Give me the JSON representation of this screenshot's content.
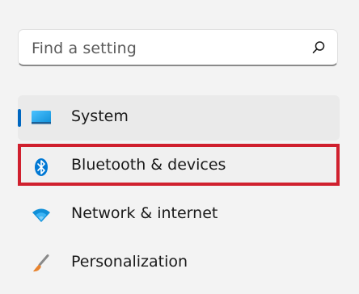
{
  "search": {
    "placeholder": "Find a setting",
    "icon": "search-icon"
  },
  "nav": {
    "items": [
      {
        "label": "System",
        "icon": "system-monitor-icon",
        "selected": true
      },
      {
        "label": "Bluetooth & devices",
        "icon": "bluetooth-icon",
        "highlighted": true
      },
      {
        "label": "Network & internet",
        "icon": "wifi-icon"
      },
      {
        "label": "Personalization",
        "icon": "paintbrush-icon"
      }
    ]
  },
  "colors": {
    "accent": "#0067c0",
    "highlight_border": "#d0202e",
    "background": "#f3f3f3"
  }
}
